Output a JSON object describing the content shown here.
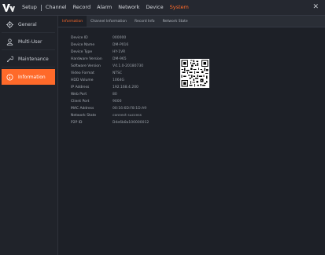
{
  "menu": {
    "items": [
      {
        "label": "Setup"
      },
      {
        "label": "Channel"
      },
      {
        "label": "Record"
      },
      {
        "label": "Alarm"
      },
      {
        "label": "Network"
      },
      {
        "label": "Device"
      },
      {
        "label": "System"
      }
    ],
    "active_color": "#ff6a2a"
  },
  "sidebar": {
    "items": [
      {
        "label": "General",
        "icon": "gear-icon"
      },
      {
        "label": "Multi-User",
        "icon": "users-icon"
      },
      {
        "label": "Maintenance",
        "icon": "wrench-icon"
      },
      {
        "label": "Information",
        "icon": "info-icon",
        "active": true
      }
    ]
  },
  "tabs": [
    {
      "label": "Information",
      "active": true
    },
    {
      "label": "Channel Information"
    },
    {
      "label": "Record Info"
    },
    {
      "label": "Network State"
    }
  ],
  "info": {
    "rows": [
      {
        "label": "Device ID",
        "value": "000000"
      },
      {
        "label": "Device Name",
        "value": "DM-P016"
      },
      {
        "label": "Device Type",
        "value": "HY-1VR"
      },
      {
        "label": "Hardware Version",
        "value": "DM-965"
      },
      {
        "label": "Software Version",
        "value": "V4.1.0-20180730"
      },
      {
        "label": "Video Format",
        "value": "NTSC"
      },
      {
        "label": "HDD Volume",
        "value": "1064G"
      },
      {
        "label": "IP Address",
        "value": "192.168.4.200"
      },
      {
        "label": "Web Port",
        "value": "80"
      },
      {
        "label": "Client Port",
        "value": "9000"
      },
      {
        "label": "MAC Address",
        "value": "00:16:6D:F8:1D:A9"
      },
      {
        "label": "Network State",
        "value": "connect success"
      },
      {
        "label": "P2P ID",
        "value": "D4e6b8a100000012"
      }
    ]
  },
  "colors": {
    "accent": "#ff6a2a",
    "background": "#1b1e24"
  }
}
